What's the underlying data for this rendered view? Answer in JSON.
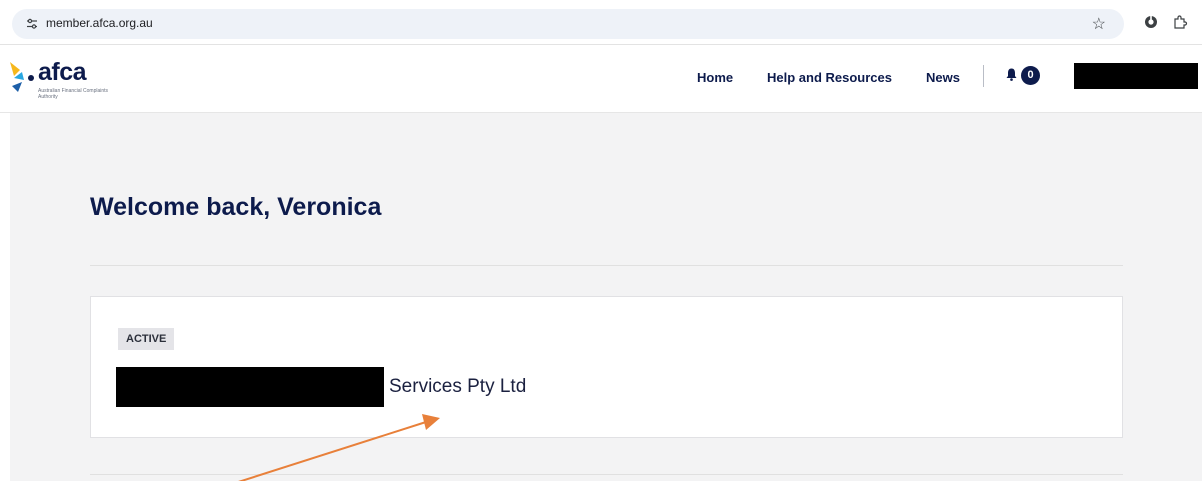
{
  "browser": {
    "url": "member.afca.org.au"
  },
  "header": {
    "logo": {
      "wordmark": "afca",
      "tagline": "Australian Financial Complaints Authority"
    },
    "nav": [
      {
        "label": "Home"
      },
      {
        "label": "Help and Resources"
      },
      {
        "label": "News"
      }
    ],
    "notification_count": "0"
  },
  "main": {
    "welcome": "Welcome back, Veronica",
    "card": {
      "status": "ACTIVE",
      "org_name_suffix": "Services Pty Ltd"
    }
  },
  "colors": {
    "brand_navy": "#0d1b4c",
    "logo_yellow": "#f6b81c",
    "logo_blue": "#29a7e1",
    "annotation_orange": "#e8803a"
  },
  "icons": {
    "site_info": "tune-icon",
    "bookmark": "star-icon",
    "extension": "extension-icon",
    "puzzle": "puzzle-icon",
    "notifications": "bell-icon"
  }
}
